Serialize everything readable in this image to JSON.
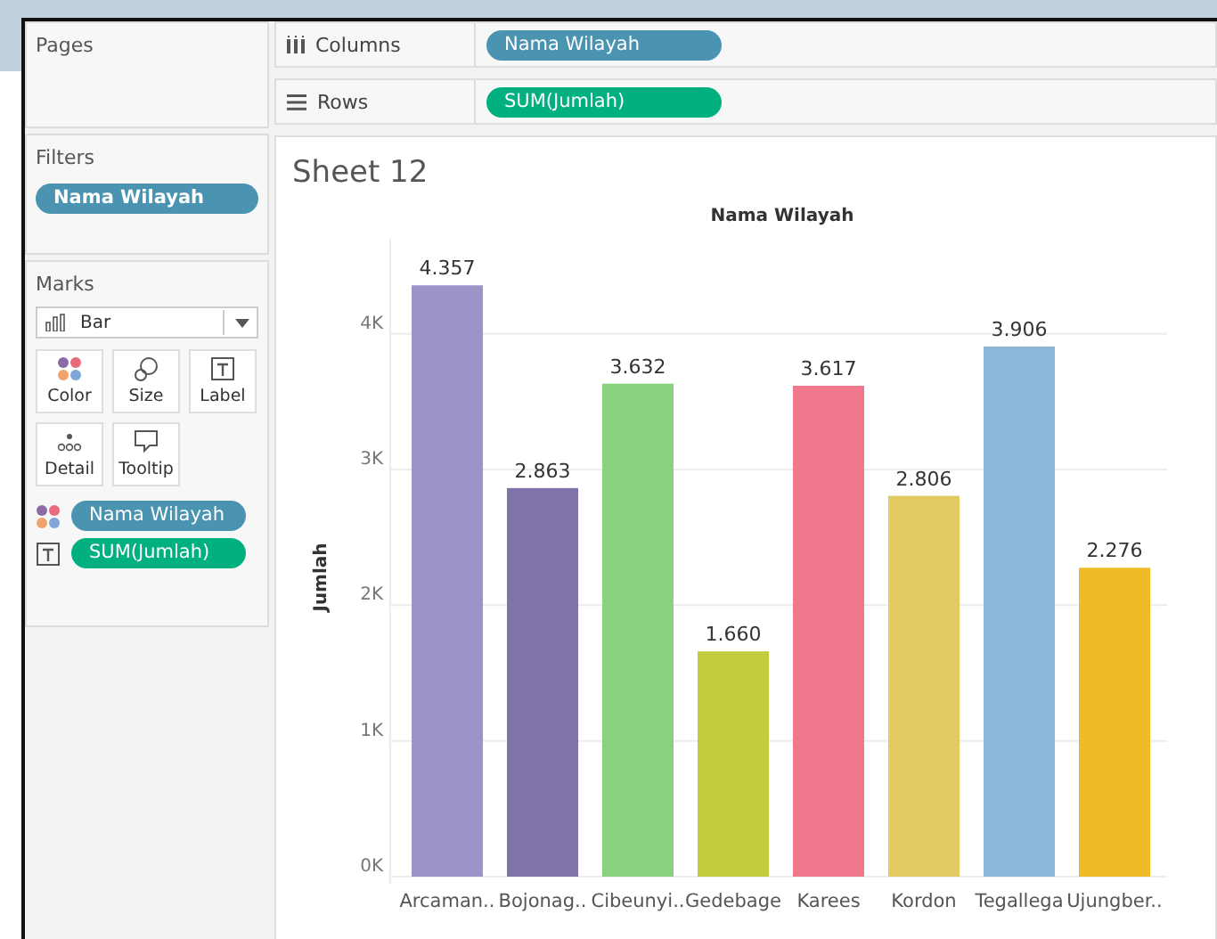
{
  "pages": {
    "title": "Pages"
  },
  "shelves": [
    {
      "kind": "columns",
      "label": "Columns",
      "pill": {
        "text": "Nama Wilayah",
        "kind": "dimension"
      }
    },
    {
      "kind": "rows",
      "label": "Rows",
      "pill": {
        "text": "SUM(Jumlah)",
        "kind": "measure"
      }
    }
  ],
  "filters": {
    "title": "Filters",
    "pills": [
      {
        "text": "Nama Wilayah",
        "kind": "dimension"
      }
    ]
  },
  "marks": {
    "title": "Marks",
    "mark_type": "Bar",
    "cards": [
      {
        "kind": "color",
        "label": "Color"
      },
      {
        "kind": "size",
        "label": "Size"
      },
      {
        "kind": "label",
        "label": "Label"
      },
      {
        "kind": "detail",
        "label": "Detail"
      },
      {
        "kind": "tooltip",
        "label": "Tooltip"
      }
    ],
    "fields": [
      {
        "kind": "color",
        "text": "Nama Wilayah",
        "color": "#4a94b1"
      },
      {
        "kind": "label",
        "text": "SUM(Jumlah)",
        "color": "#00b07e"
      }
    ]
  },
  "sheet": {
    "title": "Sheet 12",
    "chart_data": {
      "type": "bar",
      "title": "Nama Wilayah",
      "ylabel": "Jumlah",
      "categories": [
        "Arcaman..",
        "Bojonag..",
        "Cibeunyi..",
        "Gedebage",
        "Karees",
        "Kordon",
        "Tegallega",
        "Ujungber.."
      ],
      "values": [
        4357,
        2863,
        3632,
        1660,
        3617,
        2806,
        3906,
        2276
      ],
      "colors": [
        "#9d93c8",
        "#8073a9",
        "#8ad17e",
        "#c1cd3c",
        "#f0788c",
        "#e2cb62",
        "#8ab7da",
        "#f0bb27"
      ],
      "value_labels": [
        "4.357",
        "2.863",
        "3.632",
        "1.660",
        "3.617",
        "2.806",
        "3.906",
        "2.276"
      ],
      "ylim": [
        0,
        4700
      ],
      "yticks": [
        {
          "value": 0,
          "label": "0K"
        },
        {
          "value": 1000,
          "label": "1K"
        },
        {
          "value": 2000,
          "label": "2K"
        },
        {
          "value": 3000,
          "label": "3K"
        },
        {
          "value": 4000,
          "label": "4K"
        }
      ],
      "data_labels": true,
      "grid": true
    }
  }
}
